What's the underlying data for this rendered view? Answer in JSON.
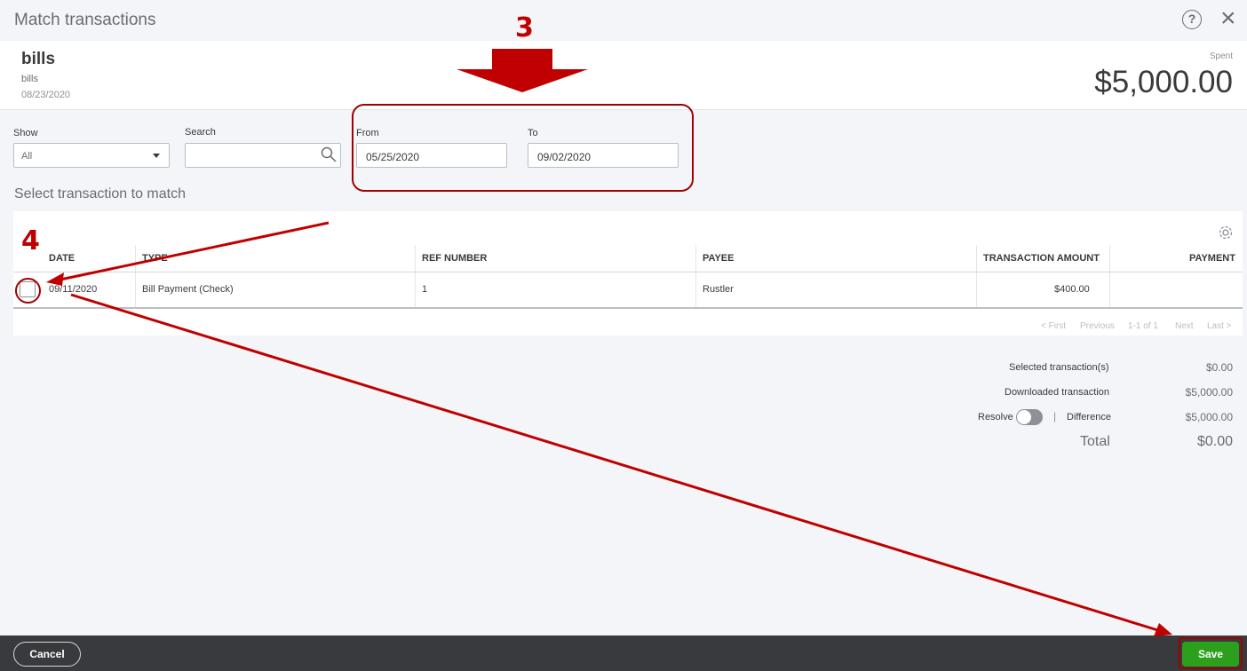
{
  "header": {
    "title": "Match transactions",
    "help_symbol": "?",
    "close_symbol": "×"
  },
  "info": {
    "title": "bills",
    "subtitle": "bills",
    "date": "08/23/2020",
    "spent_label": "Spent",
    "spent_amount": "$5,000.00"
  },
  "filters": {
    "show_label": "Show",
    "show_value": "All",
    "search_label": "Search",
    "search_value": "",
    "from_label": "From",
    "from_value": "05/25/2020",
    "to_label": "To",
    "to_value": "09/02/2020"
  },
  "section_title": "Select transaction to match",
  "table": {
    "columns": [
      "DATE",
      "TYPE",
      "REF NUMBER",
      "PAYEE",
      "TRANSACTION AMOUNT",
      "PAYMENT"
    ],
    "rows": [
      {
        "date": "09/11/2020",
        "type": "Bill Payment (Check)",
        "ref": "1",
        "payee": "Rustler",
        "amount": "$400.00",
        "payment": "",
        "checked": false
      }
    ]
  },
  "pagination": {
    "first": "< First",
    "previous": "Previous",
    "range": "1-1 of 1",
    "next": "Next",
    "last": "Last >"
  },
  "summary": {
    "selected_label": "Selected transaction(s)",
    "selected_value": "$0.00",
    "downloaded_label": "Downloaded transaction",
    "downloaded_value": "$5,000.00",
    "resolve_label": "Resolve",
    "resolve_on": false,
    "separator": "|",
    "difference_label": "Difference",
    "difference_value": "$5,000.00",
    "total_label": "Total",
    "total_value": "$0.00"
  },
  "footer": {
    "cancel_label": "Cancel",
    "save_label": "Save"
  },
  "annotations": {
    "step3": "3",
    "step4": "4",
    "color": "#c00000"
  },
  "colors": {
    "save_green": "#2ca01c",
    "footer_bg": "#393a3d",
    "annotation_red": "#c00000"
  }
}
